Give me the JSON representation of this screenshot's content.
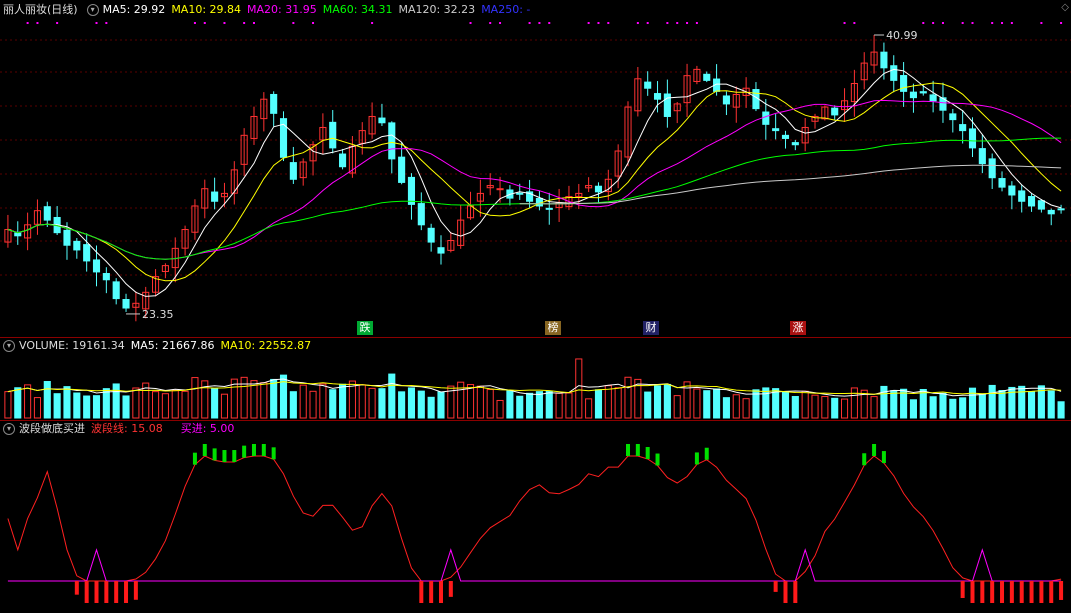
{
  "main": {
    "title": "丽人丽妆(日线)",
    "ma5": "MA5: 29.92",
    "ma10": "MA10: 29.84",
    "ma20": "MA20: 31.95",
    "ma60": "MA60: 34.31",
    "ma120": "MA120: 32.23",
    "ma250": "MA250: -",
    "high_label": "40.99",
    "low_label": "23.35",
    "event_tags": [
      "跌",
      "榜",
      "财",
      "涨"
    ],
    "colors": {
      "up": "#ff3232",
      "down": "#54ffff",
      "ma5": "#ffffff",
      "ma10": "#ffff00",
      "ma20": "#ff00ff",
      "ma60": "#00ff00",
      "ma120": "#c8c8c8",
      "ma250": "#0000ff"
    }
  },
  "volume": {
    "title": "VOLUME: 19161.34",
    "ma5": "MA5: 21667.86",
    "ma10": "MA10: 22552.87"
  },
  "indicator": {
    "title": "波段做底买进",
    "wave": "波段线: 15.08",
    "buy": "买进: 5.00"
  },
  "corner_icon": "diamond-icon",
  "chart_data": [
    {
      "type": "candlestick",
      "title": "丽人丽妆(日线)",
      "high": 40.99,
      "low": 23.35,
      "series": [
        {
          "name": "MA5",
          "last": 29.92
        },
        {
          "name": "MA10",
          "last": 29.84
        },
        {
          "name": "MA20",
          "last": 31.95
        },
        {
          "name": "MA60",
          "last": 34.31
        },
        {
          "name": "MA120",
          "last": 32.23
        }
      ],
      "close_path": [
        28.6,
        28.2,
        28.9,
        29.8,
        29.2,
        28.4,
        27.6,
        27.3,
        26.6,
        25.9,
        25.4,
        24.2,
        23.6,
        23.9,
        24.6,
        25.6,
        26.3,
        27.4,
        28.6,
        30.1,
        31.2,
        30.4,
        30.9,
        32.4,
        34.6,
        35.8,
        36.9,
        36.0,
        33.2,
        31.8,
        32.9,
        34.0,
        35.1,
        33.8,
        32.6,
        33.9,
        34.9,
        35.8,
        35.4,
        33.1,
        31.6,
        30.2,
        28.9,
        27.8,
        27.1,
        27.9,
        29.2,
        30.1,
        30.9,
        31.4,
        31.2,
        30.6,
        30.9,
        30.4,
        30.1,
        29.9,
        30.3,
        30.7,
        30.9,
        31.4,
        31.0,
        31.8,
        33.6,
        36.4,
        38.2,
        37.6,
        36.9,
        35.8,
        36.6,
        38.4,
        38.8,
        38.1,
        37.4,
        36.6,
        37.2,
        37.6,
        36.3,
        35.3,
        34.9,
        34.4,
        34.0,
        35.1,
        35.8,
        36.4,
        35.9,
        36.8,
        37.9,
        39.2,
        39.9,
        38.9,
        38.1,
        37.4,
        37.0,
        37.3,
        36.8,
        36.2,
        35.6,
        34.9,
        33.8,
        32.8,
        31.9,
        31.3,
        30.8,
        30.4,
        30.1,
        29.9,
        29.6,
        29.9
      ],
      "volume_ma5": 21667.86,
      "volume_ma10": 22552.87,
      "volume_last": 19161.34
    },
    {
      "type": "line",
      "title": "波段做底买进",
      "series": [
        {
          "name": "波段线",
          "last": 15.08
        },
        {
          "name": "买进",
          "last": 5.0
        }
      ]
    }
  ]
}
